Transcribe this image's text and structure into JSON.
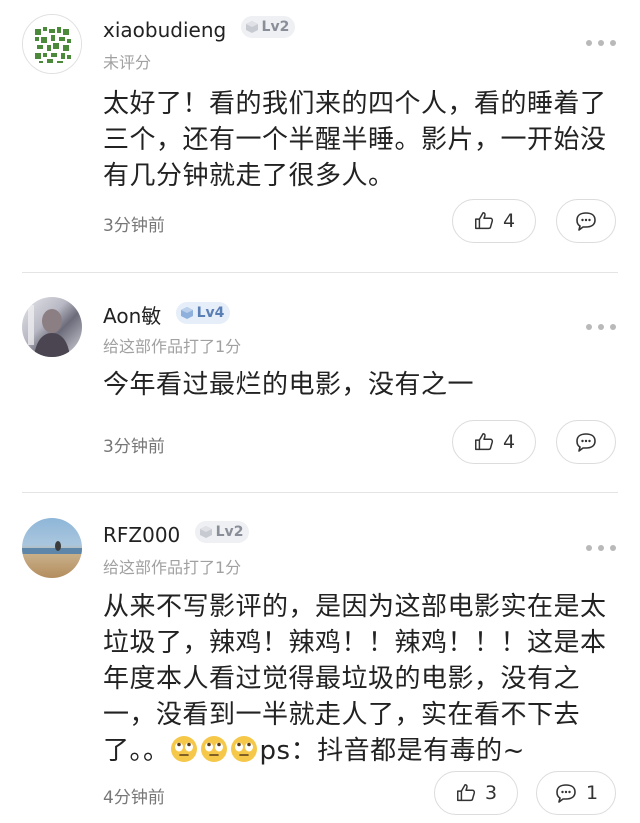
{
  "comments": [
    {
      "username": "xiaobudieng",
      "level": "Lv2",
      "rating_text": "未评分",
      "body": "太好了！看的我们来的四个人，看的睡着了三个，还有一个半醒半睡。影片，一开始没有几分钟就走了很多人。",
      "time": "3分钟前",
      "likes": "4"
    },
    {
      "username": "Aon敏",
      "level": "Lv4",
      "rating_text": "给这部作品打了1分",
      "body": "今年看过最烂的电影，没有之一",
      "time": "3分钟前",
      "likes": "4"
    },
    {
      "username": "RFZ000",
      "level": "Lv2",
      "rating_text": "给这部作品打了1分",
      "body_main": "从来不写影评的，是因为这部电影实在是太垃圾了，辣鸡！辣鸡！！辣鸡！！！这是本年度本人看过觉得最垃圾的电影，没有之一，没看到一半就走人了，实在看不下去了。。",
      "body_tail": "ps：抖音都是有毒的~",
      "emoji": "eye-roll-emoji",
      "time": "4分钟前",
      "likes": "3",
      "replies": "1"
    }
  ],
  "colors": {
    "text": "#222222",
    "meta": "#a1a1a1",
    "divider": "#e4e4e4"
  }
}
